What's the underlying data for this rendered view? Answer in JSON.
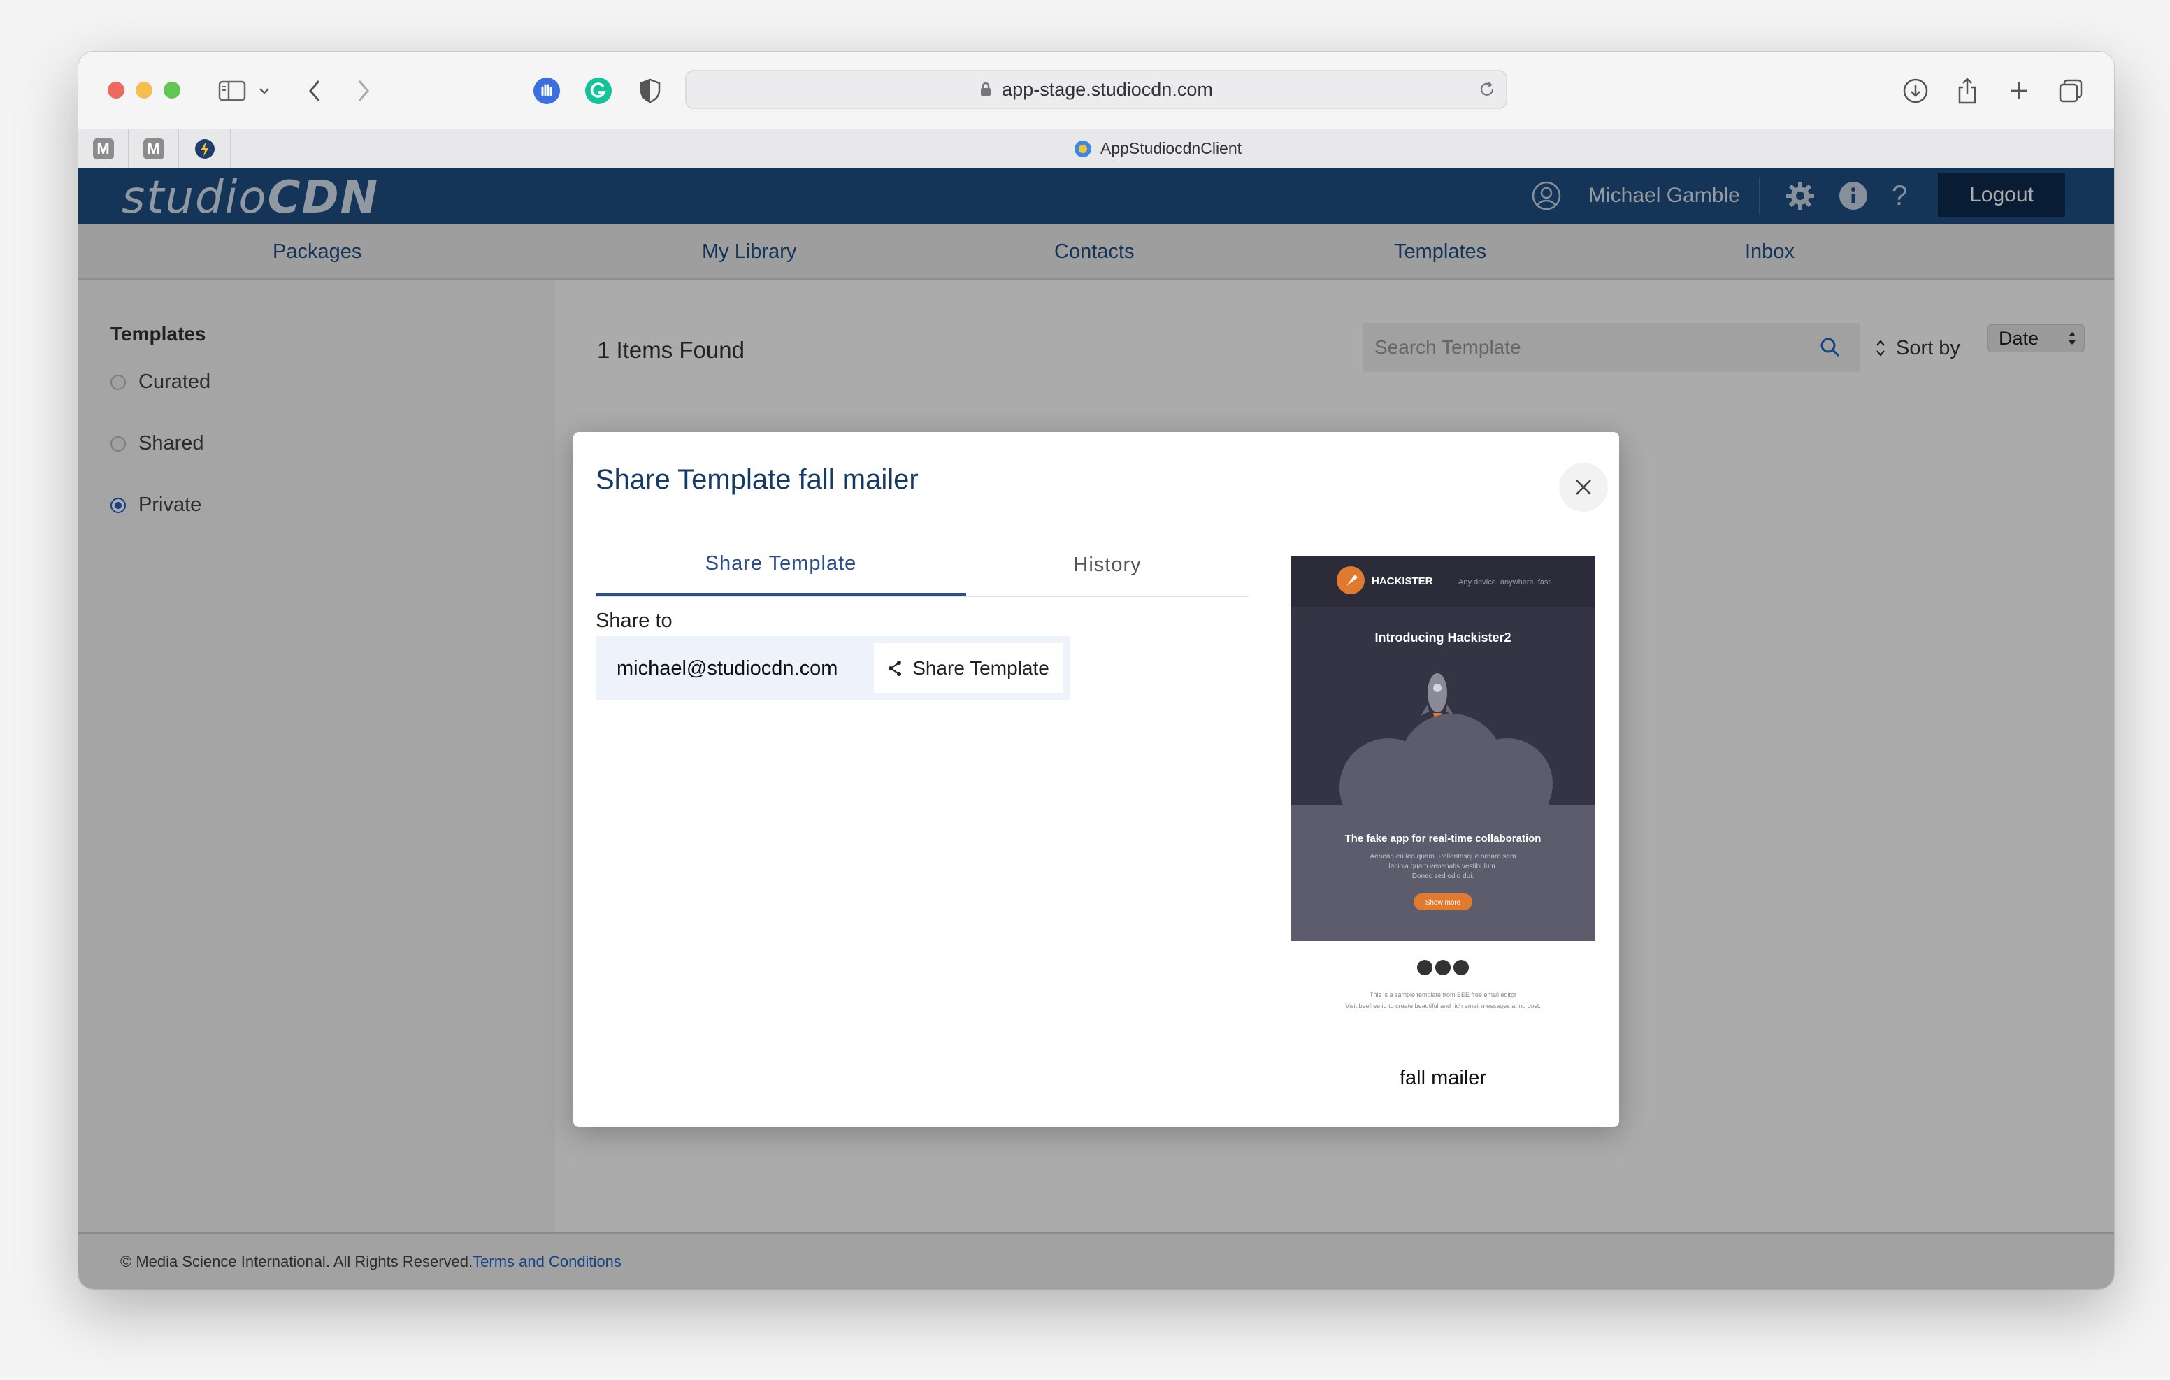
{
  "browser": {
    "url": "app-stage.studiocdn.com",
    "tab_title": "AppStudiocdnClient",
    "pinned_tabs": [
      {
        "label": "M"
      },
      {
        "label": "M"
      }
    ]
  },
  "header": {
    "logo_light": "studio",
    "logo_bold": "CDN",
    "user_name": "Michael Gamble",
    "logout_label": "Logout",
    "help_label": "?"
  },
  "nav": {
    "items": [
      "Packages",
      "My Library",
      "Contacts",
      "Templates",
      "Inbox"
    ]
  },
  "sidebar": {
    "title": "Templates",
    "options": [
      {
        "label": "Curated",
        "selected": false
      },
      {
        "label": "Shared",
        "selected": false
      },
      {
        "label": "Private",
        "selected": true
      }
    ]
  },
  "main": {
    "items_found": "1 Items Found",
    "search_placeholder": "Search Template",
    "sort_label": "Sort by",
    "sort_value": "Date"
  },
  "modal": {
    "title": "Share Template fall mailer",
    "tabs": [
      {
        "label": "Share Template",
        "active": true
      },
      {
        "label": "History",
        "active": false
      }
    ],
    "share_to_label": "Share to",
    "email": "michael@studiocdn.com",
    "share_button_label": "Share Template",
    "template_name": "fall mailer",
    "preview": {
      "brand": "HACKISTER",
      "tagline": "Any device, anywhere, fast.",
      "headline": "Introducing Hackister2",
      "subheadline": "The fake app for real-time collaboration",
      "body1": "Aenean eu leo quam. Pellentesque ornare sem",
      "body2": "lacinia quam venenatis vestibulum.",
      "body3": "Donec sed odio dui.",
      "cta": "Show more",
      "footer1": "This is a sample template from BEE free email editor",
      "footer2": "Visit beefree.io to create beautiful and rich email messages at no cost."
    }
  },
  "footer": {
    "copyright": "© Media Science International. All Rights Reserved.",
    "terms_link": "Terms and Conditions"
  },
  "colors": {
    "brand_blue": "#1f4e83",
    "logout_bg": "#0d2a4c",
    "accent_link": "#1f66c7",
    "cta_orange": "#e07a2e"
  }
}
